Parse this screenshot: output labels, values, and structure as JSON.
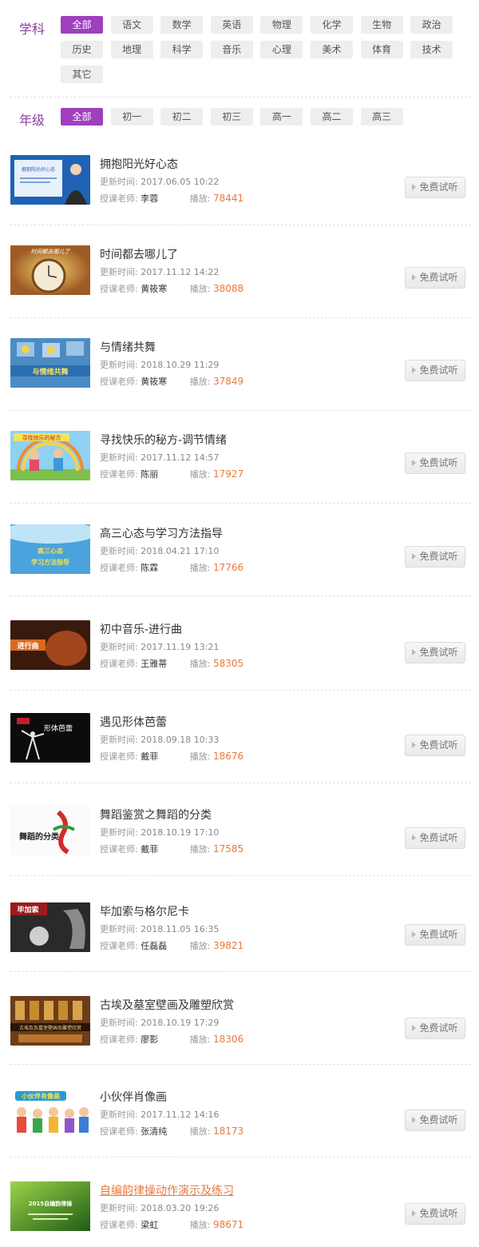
{
  "filters": {
    "subject": {
      "label": "学科",
      "options": [
        "全部",
        "语文",
        "数学",
        "英语",
        "物理",
        "化学",
        "生物",
        "政治",
        "历史",
        "地理",
        "科学",
        "音乐",
        "心理",
        "美术",
        "体育",
        "技术",
        "其它"
      ],
      "active": 0
    },
    "grade": {
      "label": "年级",
      "options": [
        "全部",
        "初一",
        "初二",
        "初三",
        "高一",
        "高二",
        "高三"
      ],
      "active": 0
    }
  },
  "list": {
    "update_label": "更新时间:",
    "teacher_label": "授课老师:",
    "plays_label": "播放:",
    "button_label": "免费试听",
    "items": [
      {
        "title": "拥抱阳光好心态",
        "updated": "2017.06.05 10:22",
        "teacher": "李蓉",
        "plays": "78441"
      },
      {
        "title": "时间都去哪儿了",
        "updated": "2017.11.12 14:22",
        "teacher": "黄筱寒",
        "plays": "38088"
      },
      {
        "title": "与情绪共舞",
        "updated": "2018.10.29 11:29",
        "teacher": "黄筱寒",
        "plays": "37849"
      },
      {
        "title": "寻找快乐的秘方-调节情绪",
        "updated": "2017.11.12 14:57",
        "teacher": "陈丽",
        "plays": "17927"
      },
      {
        "title": "高三心态与学习方法指导",
        "updated": "2018.04.21 17:10",
        "teacher": "陈霖",
        "plays": "17766"
      },
      {
        "title": "初中音乐-进行曲",
        "updated": "2017.11.19 13:21",
        "teacher": "王雅蒂",
        "plays": "58305"
      },
      {
        "title": "遇见形体芭蕾",
        "updated": "2018.09.18 10:33",
        "teacher": "戴菲",
        "plays": "18676"
      },
      {
        "title": "舞蹈鉴赏之舞蹈的分类",
        "updated": "2018.10.19 17:10",
        "teacher": "戴菲",
        "plays": "17585"
      },
      {
        "title": "毕加索与格尔尼卡",
        "updated": "2018.11.05 16:35",
        "teacher": "任磊磊",
        "plays": "39821"
      },
      {
        "title": "古埃及墓室壁画及雕塑欣赏",
        "updated": "2018.10.19 17:29",
        "teacher": "廖影",
        "plays": "18306"
      },
      {
        "title": "小伙伴肖像画",
        "updated": "2017.11.12 14:16",
        "teacher": "张清纯",
        "plays": "18173"
      },
      {
        "title": "自编韵律操动作演示及练习",
        "updated": "2018.03.20 19:26",
        "teacher": "梁虹",
        "plays": "98671"
      }
    ]
  },
  "thumbnails": [
    {
      "caption": "拥抱阳光好心态"
    },
    {
      "caption": "时间都去哪儿了"
    },
    {
      "caption": "与情绪共舞"
    },
    {
      "caption": "寻找快乐的秘方"
    },
    {
      "caption": "高三心态与学习方法指导"
    },
    {
      "caption": "进行曲"
    },
    {
      "caption": "形体芭蕾"
    },
    {
      "caption": "舞蹈的分类"
    },
    {
      "caption": "毕加索"
    },
    {
      "caption": "古埃及及墓室壁画及雕塑欣赏"
    },
    {
      "caption": "小伙伴肖像画"
    },
    {
      "caption": "2015自编韵律操"
    }
  ],
  "colors": {
    "accent": "#a03fbd",
    "label": "#8a3fa3",
    "plays": "#e8793c",
    "chip_bg": "#eeeeee"
  }
}
